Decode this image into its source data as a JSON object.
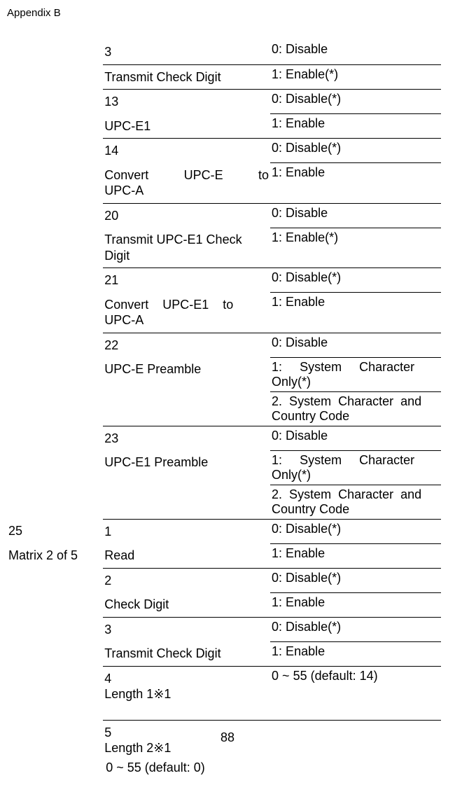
{
  "header": "Appendix B",
  "footer": "88",
  "rows": [
    {
      "col1_num": "25",
      "col1_name": "Matrix 2 of 5",
      "params": [
        {
          "num": "3",
          "name": "Transmit Check Digit",
          "opts": [
            "0: Disable",
            "1: Enable(*)"
          ]
        },
        {
          "num": "13",
          "name": "UPC-E1",
          "opts": [
            "0: Disable(*)",
            "1: Enable"
          ]
        },
        {
          "num": "14",
          "name": "Convert UPC-E to UPC-A",
          "just": true,
          "opts": [
            "0: Disable(*)",
            "1: Enable"
          ]
        },
        {
          "num": "20",
          "name": "Transmit UPC-E1 Check Digit",
          "opts": [
            "0: Disable",
            "1: Enable(*)"
          ]
        },
        {
          "num": "21",
          "name": "Convert UPC-E1 to UPC-A",
          "just": true,
          "opts": [
            "0: Disable(*)",
            "1: Enable"
          ]
        },
        {
          "num": "22",
          "name": "UPC-E Preamble",
          "opts": [
            "0: Disable",
            "1: System Character Only(*)",
            "2. System Character and Country Code"
          ],
          "optJust": [
            false,
            true,
            true
          ]
        },
        {
          "num": "23",
          "name": "UPC-E1 Preamble",
          "opts": [
            "0: Disable",
            "1: System Character Only(*)",
            "2. System Character and Country Code"
          ],
          "optJust": [
            false,
            true,
            true
          ]
        }
      ],
      "params2": [
        {
          "num": "1",
          "name": "Read",
          "opts": [
            "0: Disable(*)",
            "1: Enable"
          ]
        },
        {
          "num": "2",
          "name": "Check Digit",
          "opts": [
            "0: Disable(*)",
            "1: Enable"
          ]
        },
        {
          "num": "3",
          "name": "Transmit Check Digit",
          "opts": [
            "0: Disable(*)",
            "1: Enable"
          ]
        },
        {
          "num": "4",
          "name": "Length 1※1",
          "opts": [
            "0 ~ 55 (default: 14)"
          ],
          "tall": true
        },
        {
          "num": "5",
          "name": "Length 2※1",
          "opts": [
            "0 ~ 55 (default: 0)"
          ],
          "tall": true,
          "noBottom": true
        }
      ]
    }
  ]
}
